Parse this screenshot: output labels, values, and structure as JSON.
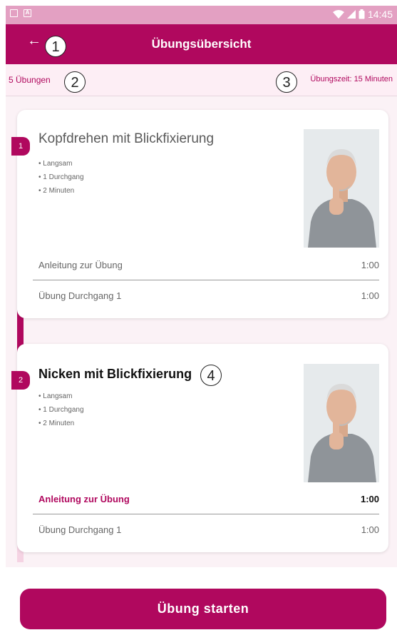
{
  "statusbar": {
    "time": "14:45",
    "icons": [
      "image-icon",
      "a-icon",
      "wifi-icon",
      "signal-icon",
      "battery-icon"
    ]
  },
  "appbar": {
    "back_icon": "←",
    "title": "Übungsübersicht"
  },
  "info": {
    "count": "5 Übungen",
    "time": "Übungszeit: 15 Minuten"
  },
  "callouts": [
    "1",
    "2",
    "3",
    "4"
  ],
  "exercises": [
    {
      "number": "1",
      "title": "Kopfdrehen mit Blickfixierung",
      "details": [
        "Langsam",
        "1 Durchgang",
        "2 Minuten"
      ],
      "rows": [
        {
          "label": "Anleitung zur Übung",
          "duration": "1:00"
        },
        {
          "label": "Übung Durchgang 1",
          "duration": "1:00"
        }
      ]
    },
    {
      "number": "2",
      "title": "Nicken mit Blickfixierung",
      "details": [
        "Langsam",
        "1 Durchgang",
        "2 Minuten"
      ],
      "rows": [
        {
          "label": "Anleitung zur Übung",
          "duration": "1:00"
        },
        {
          "label": "Übung Durchgang 1",
          "duration": "1:00"
        }
      ]
    }
  ],
  "start_button": "Übung starten",
  "colors": {
    "primary": "#b0085e",
    "statusbar": "#e3a0c2",
    "background": "#fbf2f6"
  }
}
